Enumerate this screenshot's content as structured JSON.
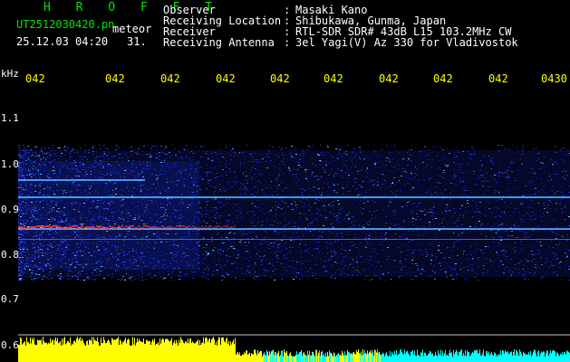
{
  "header": {
    "station": "H R O F F T",
    "filename": "UT2512030420.pn",
    "category": "meteor",
    "datetime": "25.12.03 04:20",
    "seconds": "31.",
    "labels": [
      "Observer",
      "Receiving Location",
      "Receiver",
      "Receiving Antenna"
    ],
    "colons": [
      ":",
      ":",
      ":",
      ":"
    ],
    "values": [
      "Masaki Kano",
      "Shibukawa, Gunma, Japan",
      "RTL-SDR SDR# 43dB L15 103.2MHz CW",
      "3el Yagi(V) Az 330 for Vladivostok"
    ]
  },
  "axis": {
    "unit": "kHz",
    "y_ticks": [
      "1.1",
      "1.0",
      "0.9",
      "0.8",
      "0.7",
      "0.6"
    ],
    "time_ticks": [
      "042",
      "042",
      "042",
      "042",
      "042",
      "042",
      "042",
      "042",
      "042",
      "0430"
    ]
  },
  "colors": {
    "background": "#000000",
    "header_green": "#00e600",
    "tick_yellow": "#ffff00",
    "signal_red": "#ff3030",
    "noise_blue": "#1c2ee0",
    "baseline_cyan": "#00ffff"
  }
}
